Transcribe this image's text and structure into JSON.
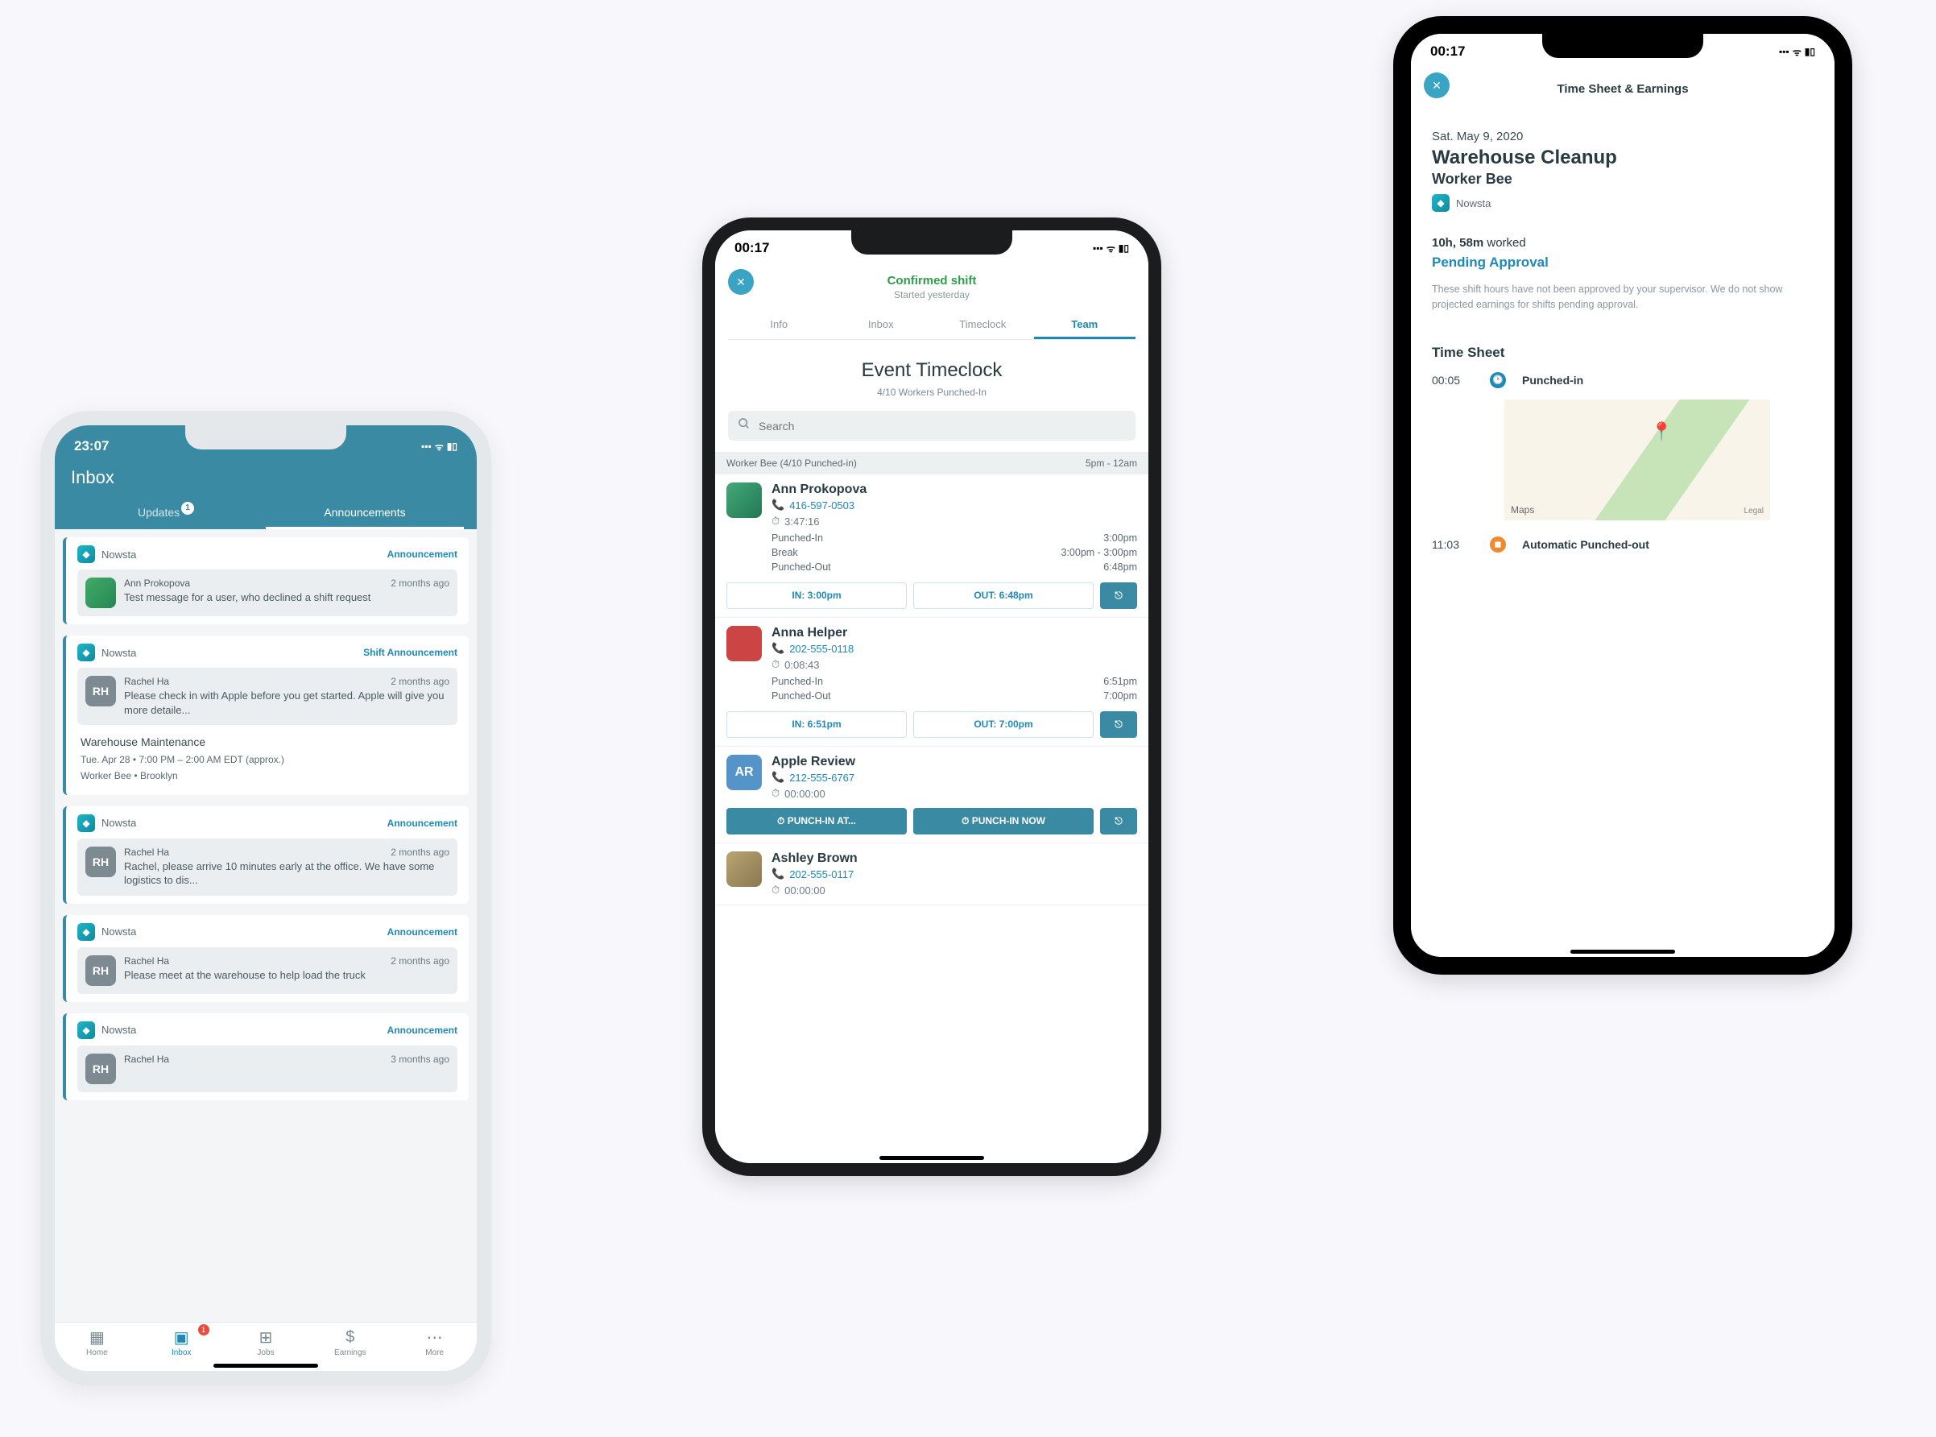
{
  "phone1": {
    "statusTime": "23:07",
    "headerTitle": "Inbox",
    "tabs": {
      "updates": "Updates",
      "updatesBadge": "1",
      "announcements": "Announcements"
    },
    "cards": [
      {
        "app": "Nowsta",
        "type": "Announcement",
        "senderName": "Ann Prokopova",
        "senderTime": "2 months ago",
        "senderInitials": "",
        "text": "Test message for a user, who declined a shift request"
      },
      {
        "app": "Nowsta",
        "type": "Shift Announcement",
        "senderName": "Rachel Ha",
        "senderTime": "2 months ago",
        "senderInitials": "RH",
        "text": "Please check in with Apple before you get started. Apple will give you more detaile...",
        "shiftTitle": "Warehouse Maintenance",
        "shiftTime": "Tue. Apr 28 • 7:00 PM – 2:00 AM EDT (approx.)",
        "shiftLoc": "Worker Bee • Brooklyn"
      },
      {
        "app": "Nowsta",
        "type": "Announcement",
        "senderName": "Rachel Ha",
        "senderTime": "2 months ago",
        "senderInitials": "RH",
        "text": "Rachel, please arrive 10 minutes early at the office. We have some logistics to dis..."
      },
      {
        "app": "Nowsta",
        "type": "Announcement",
        "senderName": "Rachel Ha",
        "senderTime": "2 months ago",
        "senderInitials": "RH",
        "text": "Please meet at the warehouse to help load the truck"
      },
      {
        "app": "Nowsta",
        "type": "Announcement",
        "senderName": "Rachel Ha",
        "senderTime": "3 months ago",
        "senderInitials": "RH",
        "text": ""
      }
    ],
    "nav": {
      "home": "Home",
      "inbox": "Inbox",
      "inboxBadge": "1",
      "jobs": "Jobs",
      "earnings": "Earnings",
      "more": "More"
    }
  },
  "phone2": {
    "statusTime": "00:17",
    "title": "Confirmed shift",
    "subtitle": "Started yesterday",
    "tabs": {
      "info": "Info",
      "inbox": "Inbox",
      "timeclock": "Timeclock",
      "team": "Team"
    },
    "heading": "Event Timeclock",
    "countText": "4/10 Workers Punched-In",
    "searchPlaceholder": "Search",
    "sectionLabel": "Worker Bee (4/10 Punched-in)",
    "sectionTime": "5pm - 12am",
    "workers": [
      {
        "name": "Ann Prokopova",
        "phone": "416-597-0503",
        "timer": "3:47:16",
        "rows": [
          {
            "label": "Punched-In",
            "value": "3:00pm"
          },
          {
            "label": "Break",
            "value": "3:00pm - 3:00pm"
          },
          {
            "label": "Punched-Out",
            "value": "6:48pm"
          }
        ],
        "inBtn": "IN: 3:00pm",
        "outBtn": "OUT: 6:48pm"
      },
      {
        "name": "Anna Helper",
        "phone": "202-555-0118",
        "timer": "0:08:43",
        "rows": [
          {
            "label": "Punched-In",
            "value": "6:51pm"
          },
          {
            "label": "Punched-Out",
            "value": "7:00pm"
          }
        ],
        "inBtn": "IN: 6:51pm",
        "outBtn": "OUT: 7:00pm"
      },
      {
        "name": "Apple Review",
        "initials": "AR",
        "phone": "212-555-6767",
        "timer": "00:00:00",
        "punchInAt": "PUNCH-IN AT...",
        "punchInNow": "PUNCH-IN NOW"
      },
      {
        "name": "Ashley Brown",
        "phone": "202-555-0117",
        "timer": "00:00:00"
      }
    ]
  },
  "phone3": {
    "statusTime": "00:17",
    "headerTitle": "Time Sheet & Earnings",
    "date": "Sat. May 9, 2020",
    "job": "Warehouse Cleanup",
    "role": "Worker Bee",
    "company": "Nowsta",
    "hoursBold": "10h, 58m",
    "hoursSuffix": " worked",
    "status": "Pending Approval",
    "note": "These shift hours have not been approved by your supervisor. We do not show projected earnings for shifts pending approval.",
    "sectionTitle": "Time Sheet",
    "entries": [
      {
        "time": "00:05",
        "label": "Punched-in",
        "icon": "clock"
      },
      {
        "time": "11:03",
        "label": "Automatic Punched-out",
        "icon": "stop"
      }
    ],
    "mapProvider": "Maps",
    "mapLegal": "Legal"
  }
}
